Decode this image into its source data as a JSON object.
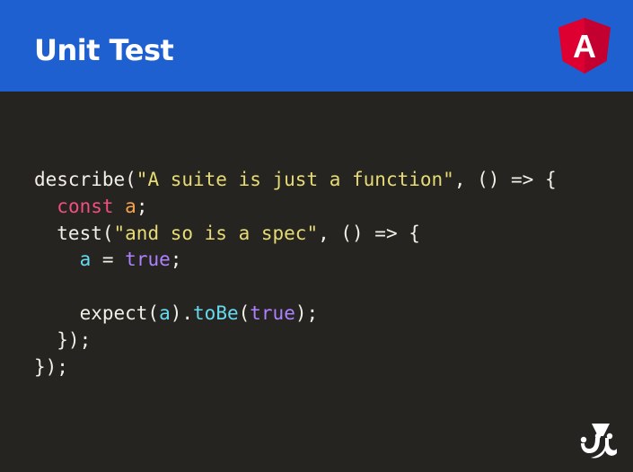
{
  "slide": {
    "title": "Unit Test",
    "header_color": "#1e60cf",
    "background_color": "#262421"
  },
  "logo": {
    "icon": "angular-logo-icon",
    "letter": "A",
    "color": "#dd0031"
  },
  "code": {
    "language": "javascript",
    "lines": [
      [
        {
          "t": "describe(",
          "c": "plain"
        },
        {
          "t": "\"A suite is just a function\"",
          "c": "str"
        },
        {
          "t": ", () => {",
          "c": "plain"
        }
      ],
      [
        {
          "t": "  ",
          "c": "plain"
        },
        {
          "t": "const",
          "c": "kw"
        },
        {
          "t": " ",
          "c": "plain"
        },
        {
          "t": "a",
          "c": "var-o"
        },
        {
          "t": ";",
          "c": "plain"
        }
      ],
      [
        {
          "t": "  test(",
          "c": "plain"
        },
        {
          "t": "\"and so is a spec\"",
          "c": "str"
        },
        {
          "t": ", () => {",
          "c": "plain"
        }
      ],
      [
        {
          "t": "    ",
          "c": "plain"
        },
        {
          "t": "a",
          "c": "var-c"
        },
        {
          "t": " = ",
          "c": "plain"
        },
        {
          "t": "true",
          "c": "const"
        },
        {
          "t": ";",
          "c": "plain"
        }
      ],
      [],
      [
        {
          "t": "    expect(",
          "c": "plain"
        },
        {
          "t": "a",
          "c": "var-c"
        },
        {
          "t": ").",
          "c": "plain"
        },
        {
          "t": "toBe",
          "c": "fn"
        },
        {
          "t": "(",
          "c": "plain"
        },
        {
          "t": "true",
          "c": "const"
        },
        {
          "t": ");",
          "c": "plain"
        }
      ],
      [
        {
          "t": "  });",
          "c": "plain"
        }
      ],
      [
        {
          "t": "});",
          "c": "plain"
        }
      ]
    ]
  },
  "footer": {
    "icon": "jest-logo-icon"
  }
}
